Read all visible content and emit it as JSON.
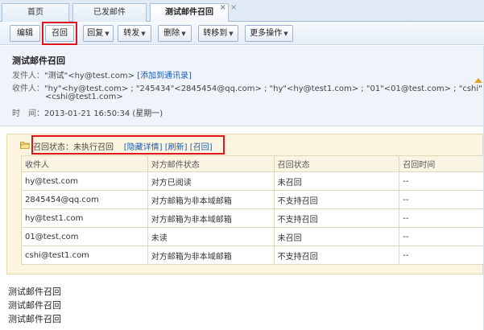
{
  "tabs": [
    {
      "label": "首页"
    },
    {
      "label": "已发邮件"
    },
    {
      "label": "测试邮件召回"
    }
  ],
  "tab_close_glyph": "×",
  "tab_new_glyph": "×",
  "toolbar": {
    "edit": "编辑",
    "recall": "召回",
    "reply": "回复",
    "forward": "转发",
    "delete": "删除",
    "move": "转移到",
    "more": "更多操作"
  },
  "mail": {
    "subject": "测试邮件召回",
    "from_label": "发件人：",
    "from_value": "\"测试\"<hy@test.com>",
    "add_contact": "[添加到通讯录]",
    "to_label": "收件人：",
    "to_value": "\"hy\"<hy@test.com> ; \"245434\"<2845454@qq.com> ; \"hy\"<hy@test1.com> ; \"01\"<01@test.com> ; \"cshi\"",
    "to_value_cont": "<cshi@test1.com>",
    "time_label": "时　间：",
    "time_value": "2013-01-21 16:50:34 (星期一)"
  },
  "recall": {
    "status_label": "召回状态：未执行召回",
    "hide_details": "[隐藏详情]",
    "refresh": "[刷新]",
    "recall_link": "[召回]",
    "columns": [
      "收件人",
      "对方邮件状态",
      "召回状态",
      "召回时间"
    ],
    "rows": [
      [
        "hy@test.com",
        "对方已阅读",
        "未召回",
        "--"
      ],
      [
        "2845454@qq.com",
        "对方邮箱为非本域邮箱",
        "不支持召回",
        "--"
      ],
      [
        "hy@test1.com",
        "对方邮箱为非本域邮箱",
        "不支持召回",
        "--"
      ],
      [
        "01@test.com",
        "未读",
        "未召回",
        "--"
      ],
      [
        "cshi@test1.com",
        "对方邮箱为非本域邮箱",
        "不支持召回",
        "--"
      ]
    ]
  },
  "body_lines": [
    "测试邮件召回",
    "测试邮件召回",
    "测试邮件召回"
  ],
  "colors": {
    "highlight_box": "#e0141e",
    "link": "#1c5bb5",
    "recall_panel_bg": "#fdf5df"
  }
}
